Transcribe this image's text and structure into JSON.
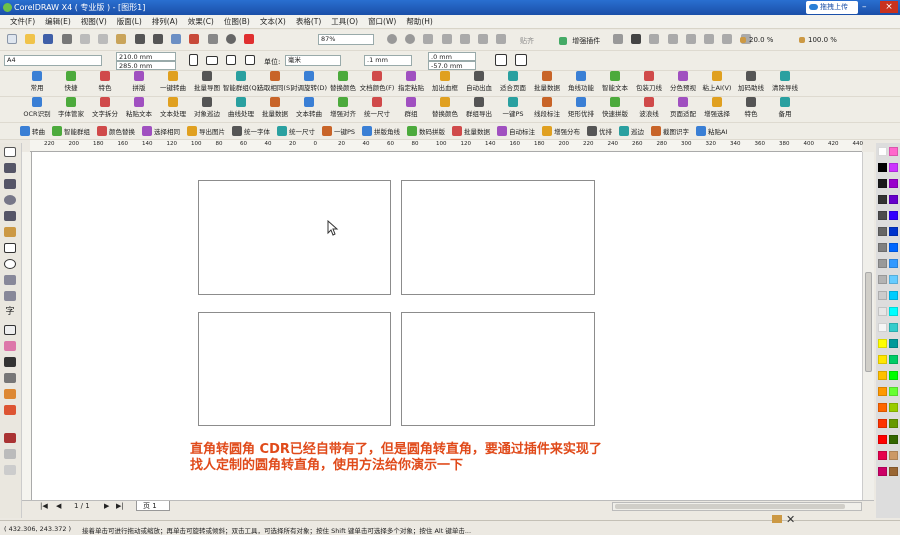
{
  "window": {
    "title": "CorelDRAW X4 ( 专业版 ) - [图形1]",
    "cloud_label": "拖拽上传"
  },
  "menu": [
    "文件(F)",
    "编辑(E)",
    "视图(V)",
    "版面(L)",
    "排列(A)",
    "效果(C)",
    "位图(B)",
    "文本(X)",
    "表格(T)",
    "工具(O)",
    "窗口(W)",
    "帮助(H)"
  ],
  "std_toolbar": {
    "zoom": "87%",
    "snap_label": "贴齐",
    "enhance_plugin": "增强插件",
    "scale_x": "20.0 %",
    "scale_y": "100.0 %"
  },
  "property_bar": {
    "paper": "A4",
    "width": "210.0 mm",
    "height": "285.0 mm",
    "unit_label": "单位:",
    "unit": "毫米",
    "nudge": ".1 mm",
    "dup_x": ".0 mm",
    "dup_y": "-57.0 mm"
  },
  "plugin_row1": [
    "常用",
    "快捷",
    "特色",
    "拼版",
    "一键转曲",
    "批量导图",
    "智能群组(Q)",
    "选取相同(S)",
    "对调旋转(D)",
    "替换颜色",
    "文档颜色(F)",
    "指定粘贴",
    "加出血框",
    "自动出血",
    "适合页面",
    "批量数据",
    "角线功能",
    "智能文本",
    "包装刀线",
    "分色预视",
    "粘上AI(V)",
    "加码助线",
    "清除导线"
  ],
  "plugin_row2": [
    "OCR识别",
    "字体管家",
    "文字拆分",
    "粘贴文本",
    "文本处理",
    "对象巡边",
    "曲线处理",
    "批量数据",
    "文本转曲",
    "增强对齐",
    "统一尺寸",
    "群组",
    "替换颜色",
    "群组导出",
    "一键PS",
    "线段标注",
    "矩形优排",
    "快速拼版",
    "波浪线",
    "页面适配",
    "增强选择",
    "特色",
    "备用"
  ],
  "plugin_row3": [
    "转曲",
    "智能群组",
    "颜色替换",
    "选择相同",
    "导出图片",
    "统一字体",
    "统一尺寸",
    "一键PS",
    "拼版角线",
    "数码拼版",
    "批量数据",
    "自动标注",
    "增强分布",
    "优排",
    "巡边",
    "截图识字",
    "粘贴AI"
  ],
  "ruler_top": [
    "220",
    "200",
    "180",
    "160",
    "140",
    "120",
    "100",
    "80",
    "60",
    "40",
    "20",
    "0",
    "20",
    "40",
    "60",
    "80",
    "100",
    "120",
    "140",
    "160",
    "180",
    "200",
    "220",
    "240",
    "260",
    "280",
    "300",
    "320",
    "340",
    "360",
    "380",
    "400",
    "420",
    "440"
  ],
  "pages": {
    "counter": "1 / 1",
    "tab": "页 1"
  },
  "status": {
    "coords": "( 432.306, 243.372 )",
    "hint": "接着单击可进行拖动或缩放；再单击可旋转或倾斜；双击工具，可选择所有对象；按住 Shift 键单击可选择多个对象；按住 Alt 键单击..."
  },
  "caption": {
    "line1": "直角转圆角 CDR已经自带有了，但是圆角转直角，要通过插件来实现了",
    "line2": "找人定制的圆角转直角，使用方法给你演示一下"
  },
  "palette_colors": [
    "#ffffff",
    "#000000",
    "#1a1a1a",
    "#333333",
    "#4d4d4d",
    "#666666",
    "#808080",
    "#999999",
    "#b3b3b3",
    "#cccccc",
    "#e6e6e6",
    "#f5f5f5",
    "#ffff00",
    "#ffe600",
    "#ffc000",
    "#ff9900",
    "#ff6600",
    "#ff3300",
    "#ff0000",
    "#e6004c",
    "#cc0066",
    "#ff66cc",
    "#cc33ff",
    "#9900cc",
    "#6600cc",
    "#3300ff",
    "#0033cc",
    "#0066ff",
    "#3399ff",
    "#66ccff",
    "#00ccff",
    "#00ffff",
    "#33cccc",
    "#009999",
    "#00cc66",
    "#00ff00",
    "#66ff33",
    "#99cc00",
    "#669900",
    "#336600",
    "#cc9966",
    "#996633"
  ]
}
